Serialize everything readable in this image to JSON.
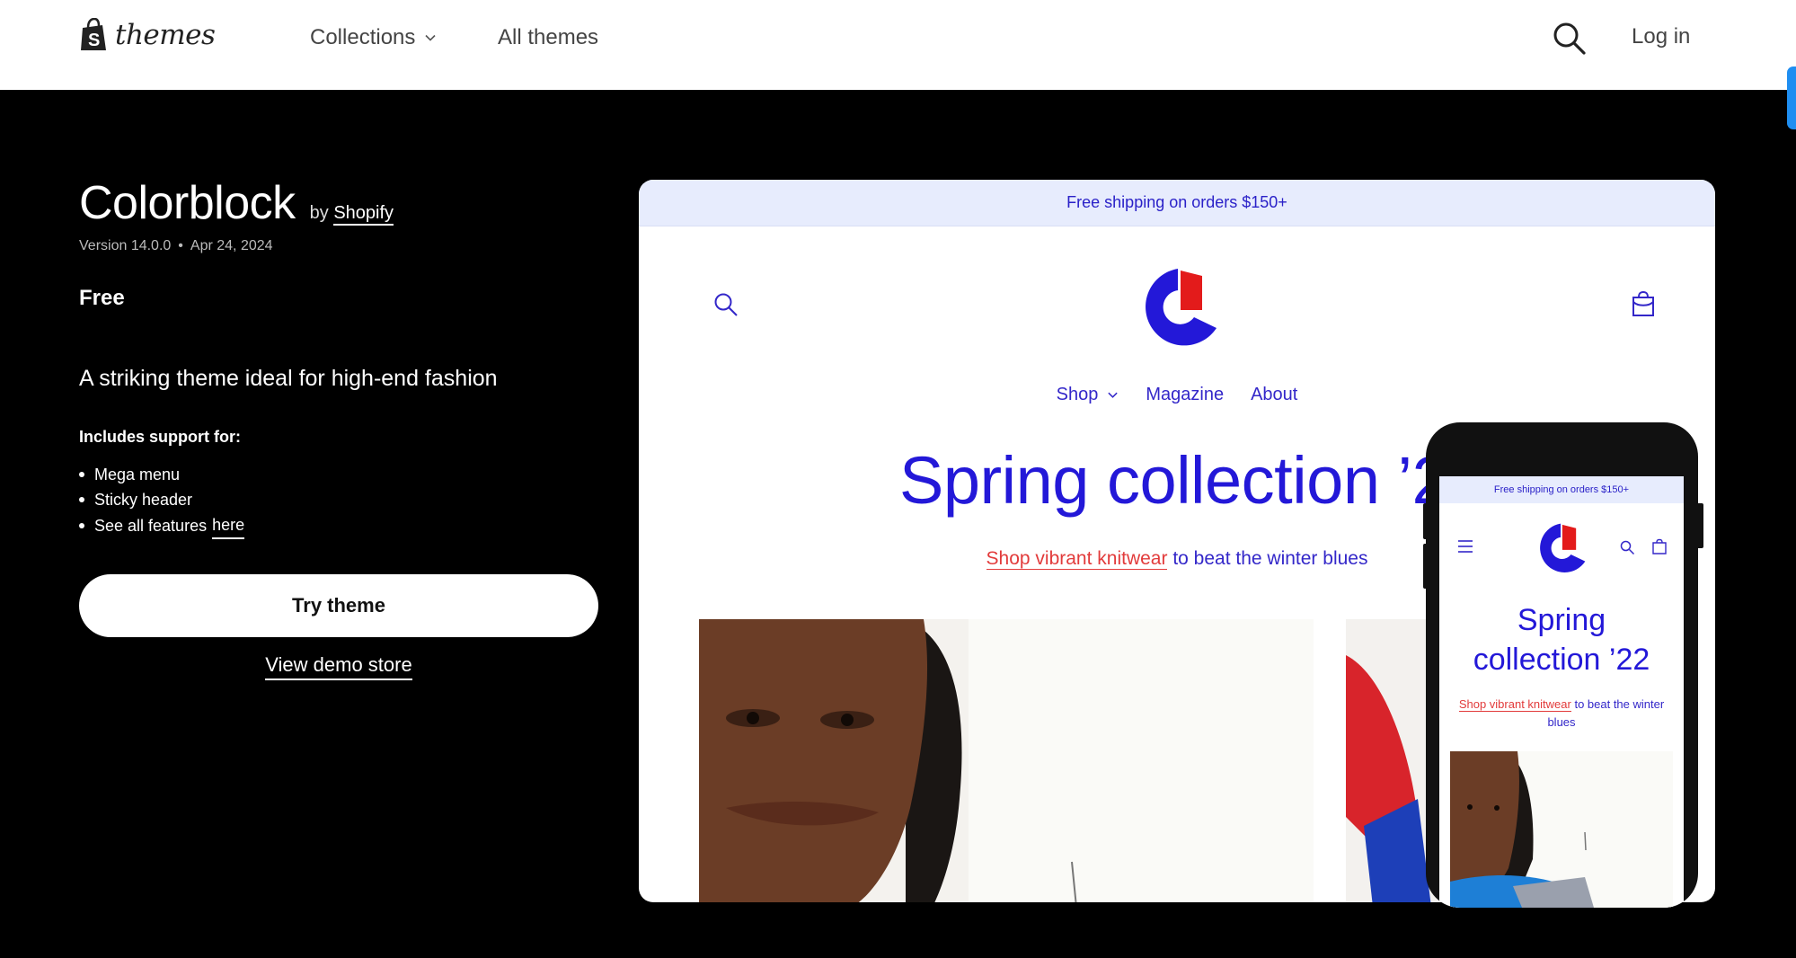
{
  "topnav": {
    "logo_text": "themes",
    "collections_label": "Collections",
    "all_themes_label": "All themes",
    "login_label": "Log in"
  },
  "theme": {
    "name": "Colorblock",
    "by_prefix": "by",
    "author": "Shopify",
    "version": "Version 14.0.0",
    "date": "Apr 24, 2024",
    "price": "Free",
    "tagline": "A striking theme ideal for high-end fashion",
    "support_heading": "Includes support for:",
    "features": [
      "Mega menu",
      "Sticky header"
    ],
    "features_more_prefix": "See all features",
    "features_more_link": "here",
    "try_label": "Try theme",
    "demo_label": "View demo store"
  },
  "preview": {
    "banner": "Free shipping on orders $150+",
    "menu": [
      "Shop",
      "Magazine",
      "About"
    ],
    "headline": "Spring collection ’22",
    "sub_link": "Shop vibrant knitwear",
    "sub_rest": "to beat the winter blues"
  },
  "phone": {
    "banner": "Free shipping on orders $150+",
    "headline_line1": "Spring",
    "headline_line2": "collection ’22",
    "sub_link": "Shop vibrant knitwear",
    "sub_rest": "to beat the winter blues"
  },
  "colors": {
    "brand_blue": "#2318d8",
    "brand_red": "#e31b1b",
    "banner_bg": "#e7ecfd",
    "accent_tab": "#1f8ef1"
  }
}
